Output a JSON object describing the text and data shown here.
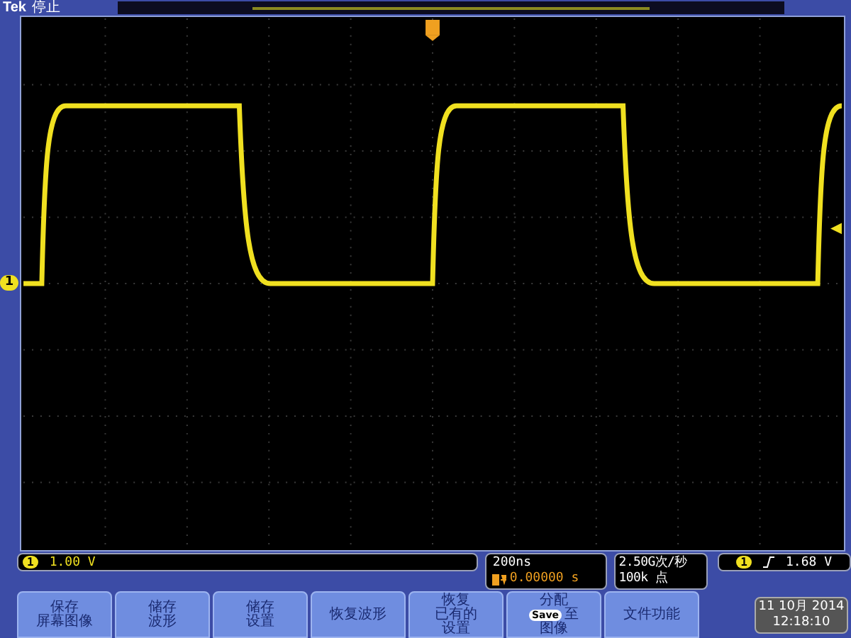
{
  "header": {
    "brand": "Tek",
    "run_state": "停止"
  },
  "channel_marker": "1",
  "status": {
    "channel": {
      "number": "1",
      "scale": "1.00 V"
    },
    "timebase": {
      "scale": "200ns",
      "position": "0.00000 s"
    },
    "acquisition": {
      "rate": "2.50G次/秒",
      "points": "100k 点"
    },
    "trigger": {
      "source": "1",
      "level": "1.68 V"
    }
  },
  "buttons": [
    {
      "kind": "text",
      "lines": [
        "保存",
        "屏幕图像"
      ]
    },
    {
      "kind": "text",
      "lines": [
        "储存",
        "波形"
      ]
    },
    {
      "kind": "text",
      "lines": [
        "储存",
        "设置"
      ]
    },
    {
      "kind": "text",
      "lines": [
        "恢复波形"
      ]
    },
    {
      "kind": "text",
      "lines": [
        "恢复",
        "已有的",
        "设置"
      ]
    },
    {
      "kind": "badge",
      "badge": "Save",
      "lines": [
        "分配",
        "至",
        "图像"
      ]
    },
    {
      "kind": "text",
      "lines": [
        "文件功能"
      ]
    }
  ],
  "clock": {
    "date": "11 10月 2014",
    "time": "12:18:10"
  }
}
